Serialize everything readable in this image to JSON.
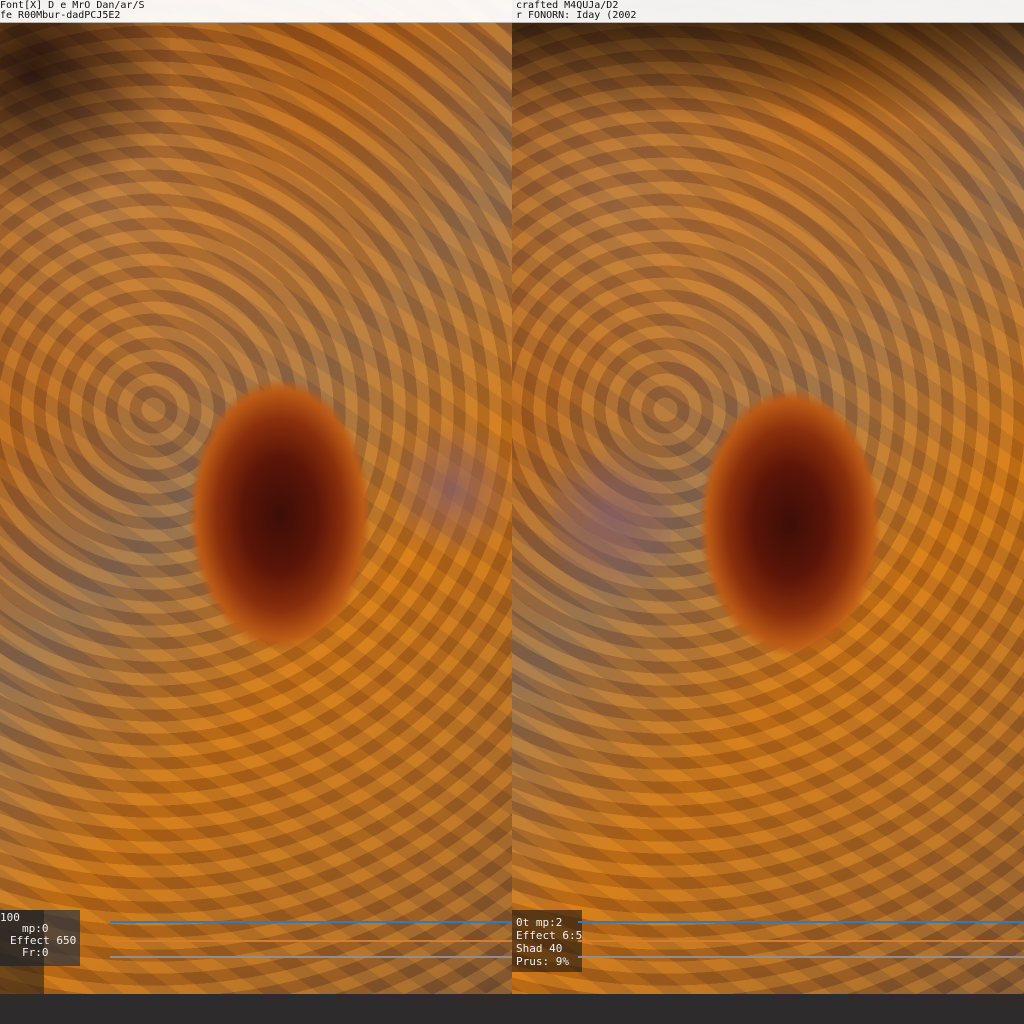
{
  "header": {
    "left_line1": "Font[X] D e MrO Dan/ar/S",
    "left_line2": "fe R00Mbur-dadPCJ5E2",
    "right_line1": "crafted M4QUJa/D2",
    "right_line2": "r FONORN: Iday (2002"
  },
  "overlay": {
    "left": {
      "line1": "100",
      "line2": "mp:0",
      "line3": "Effect 650",
      "line4": "Fr:0"
    },
    "right": {
      "line1": "0t mp:2",
      "line2": "Effect 6:5",
      "line3": "Shad 40",
      "line4": "Prus: 9%"
    }
  },
  "colors": {
    "blue_line": "#2b7bc7",
    "orange_line": "#d77c2b",
    "gray_line": "#8a8f98"
  }
}
